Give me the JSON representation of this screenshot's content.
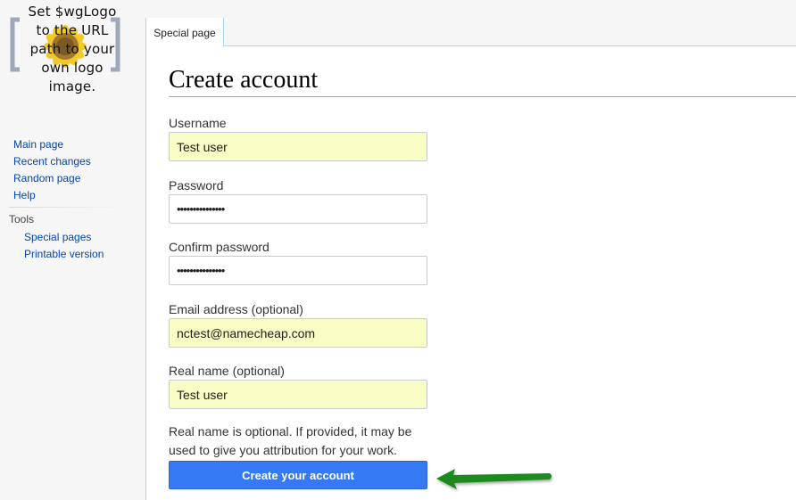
{
  "logo": {
    "text_lines": [
      "Set $wgLogo",
      "to the URL",
      "path to your",
      "own logo",
      "image."
    ]
  },
  "sidebar": {
    "navigation": [
      {
        "label": "Main page"
      },
      {
        "label": "Recent changes"
      },
      {
        "label": "Random page"
      },
      {
        "label": "Help"
      }
    ],
    "tools_heading": "Tools",
    "tools": [
      {
        "label": "Special pages"
      },
      {
        "label": "Printable version"
      }
    ]
  },
  "tabs": [
    {
      "label": "Special page"
    }
  ],
  "main": {
    "title": "Create account",
    "fields": {
      "username": {
        "label": "Username",
        "value": "Test user"
      },
      "password": {
        "label": "Password",
        "value": "•••••••••••••••"
      },
      "confirm_password": {
        "label": "Confirm password",
        "value": "•••••••••••••••"
      },
      "email": {
        "label": "Email address (optional)",
        "value": "nctest@namecheap.com"
      },
      "real_name": {
        "label": "Real name (optional)",
        "value": "Test user"
      }
    },
    "help_text": "Real name is optional. If provided, it may be used to give you attribution for your work.",
    "submit_label": "Create your account"
  },
  "colors": {
    "link": "#0645ad",
    "button": "#3679f5",
    "autofill_bg": "#fafcc5",
    "annotation_arrow": "#1f8a1f"
  },
  "icons": {
    "logo": "sunflower-placeholder-logo",
    "annotation": "arrow-left-icon"
  }
}
